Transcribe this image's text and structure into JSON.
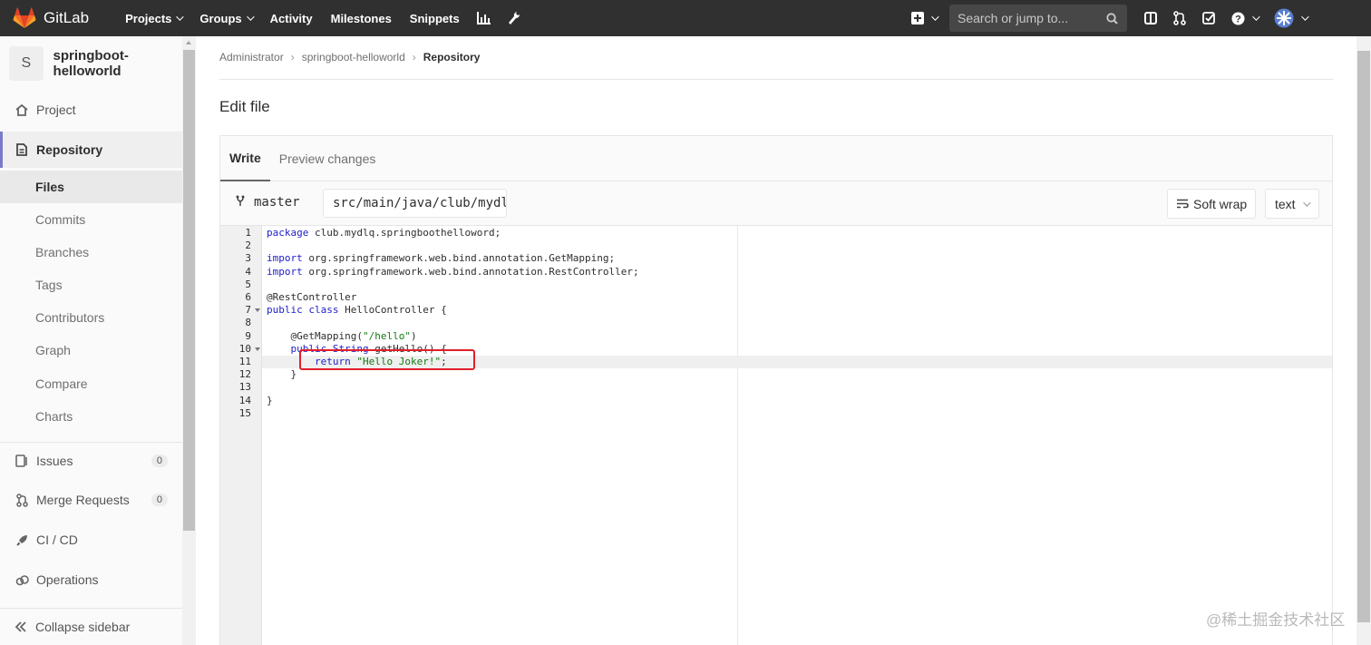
{
  "navbar": {
    "brand": "GitLab",
    "links": [
      {
        "label": "Projects",
        "dropdown": true
      },
      {
        "label": "Groups",
        "dropdown": true
      },
      {
        "label": "Activity",
        "dropdown": false
      },
      {
        "label": "Milestones",
        "dropdown": false
      },
      {
        "label": "Snippets",
        "dropdown": false
      }
    ],
    "search_placeholder": "Search or jump to...",
    "accent": "#e24329"
  },
  "sidebar": {
    "project_initial": "S",
    "project_name": "springboot-helloworld",
    "items": [
      {
        "label": "Project",
        "icon": "home-icon"
      },
      {
        "label": "Repository",
        "icon": "doc-icon"
      },
      {
        "label": "Issues",
        "icon": "issues-icon",
        "badge": "0"
      },
      {
        "label": "Merge Requests",
        "icon": "merge-icon",
        "badge": "0"
      },
      {
        "label": "CI / CD",
        "icon": "rocket-icon"
      },
      {
        "label": "Operations",
        "icon": "cloud-icon"
      }
    ],
    "subitems": [
      "Files",
      "Commits",
      "Branches",
      "Tags",
      "Contributors",
      "Graph",
      "Compare",
      "Charts"
    ],
    "collapse_label": "Collapse sidebar"
  },
  "breadcrumb": [
    "Administrator",
    "springboot-helloworld",
    "Repository"
  ],
  "page_title": "Edit file",
  "editor": {
    "tabs": [
      "Write",
      "Preview changes"
    ],
    "branch": "master",
    "file_path": "src/main/java/club/mydlq/springboothelloword/HelloController.java",
    "soft_wrap_label": "Soft wrap",
    "mode": "text",
    "lines": [
      "package club.mydlq.springboothelloword;",
      "",
      "import org.springframework.web.bind.annotation.GetMapping;",
      "import org.springframework.web.bind.annotation.RestController;",
      "",
      "@RestController",
      "public class HelloController {",
      "",
      "    @GetMapping(\"/hello\")",
      "    public String getHello() {",
      "        return \"Hello Joker!\";",
      "    }",
      "",
      "}",
      ""
    ]
  },
  "watermark": "@稀土掘金技术社区"
}
